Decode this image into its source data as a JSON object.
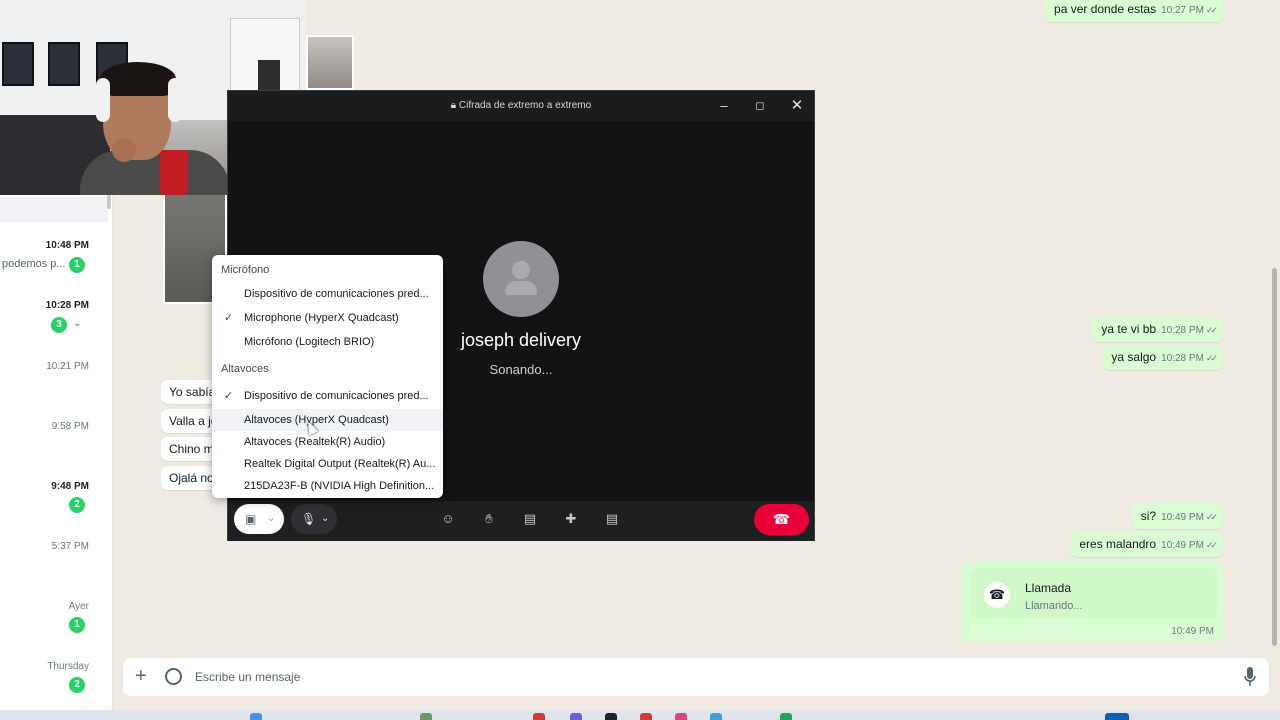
{
  "chat_list": {
    "items": [
      {
        "time": "10:48 PM",
        "preview": "podemos p...",
        "badge": "1"
      },
      {
        "time": "10:28 PM",
        "badge": "3"
      },
      {
        "time": "10:21 PM"
      },
      {
        "time": "9:58 PM"
      },
      {
        "time": "9:48 PM",
        "badge": "2"
      },
      {
        "time": "5:37 PM"
      },
      {
        "time": "Ayer",
        "badge": "1"
      },
      {
        "time": "Thursday",
        "badge": "2"
      }
    ]
  },
  "incoming_messages": [
    "Yo sabía",
    "Valla a jo",
    "Chino m",
    "Ojalá no"
  ],
  "outgoing_messages": [
    {
      "text": "pa ver donde estas",
      "time": "10:27 PM"
    },
    {
      "text": "ya te vi bb",
      "time": "10:28 PM"
    },
    {
      "text": "ya salgo",
      "time": "10:28 PM"
    },
    {
      "text": "si?",
      "time": "10:49 PM"
    },
    {
      "text": "eres malandro",
      "time": "10:49 PM"
    }
  ],
  "call_card": {
    "title": "Llamada",
    "subtitle": "Llamando...",
    "time": "10:49 PM"
  },
  "composer": {
    "placeholder": "Escribe un mensaje"
  },
  "call_window": {
    "encryption_label": "Cifrada de extremo a extremo",
    "contact_name": "joseph delivery",
    "status": "Sonando..."
  },
  "device_menu": {
    "microphone_header": "Micrófono",
    "microphones": [
      {
        "label": "Dispositivo de comunicaciones pred...",
        "selected": false
      },
      {
        "label": "Microphone (HyperX Quadcast)",
        "selected": true
      },
      {
        "label": "Micrófono (Logitech BRIO)",
        "selected": false
      }
    ],
    "speakers_header": "Altavoces",
    "speakers": [
      {
        "label": "Dispositivo de comunicaciones pred...",
        "selected": true
      },
      {
        "label": "Altavoces (HyperX Quadcast)",
        "selected": false
      },
      {
        "label": "Altavoces (Realtek(R) Audio)",
        "selected": false
      },
      {
        "label": "Realtek Digital Output (Realtek(R) Au...",
        "selected": false
      },
      {
        "label": "215DA23F-B (NVIDIA High Definition...",
        "selected": false
      }
    ],
    "check_glyph": "✓"
  },
  "colors": {
    "outgoing_bubble": "#d9fdd3",
    "hangup": "#ea0038",
    "unread_badge": "#25d366",
    "chat_background": "#efeae2"
  },
  "icons": [
    "plus-icon",
    "sticker-icon",
    "mic-icon",
    "phone-icon",
    "lock-icon",
    "camera-off-icon",
    "chevron-down-icon",
    "emoji-icon",
    "raise-hand-icon",
    "screen-share-icon",
    "add-participant-icon",
    "captions-icon",
    "hang-up-icon"
  ]
}
